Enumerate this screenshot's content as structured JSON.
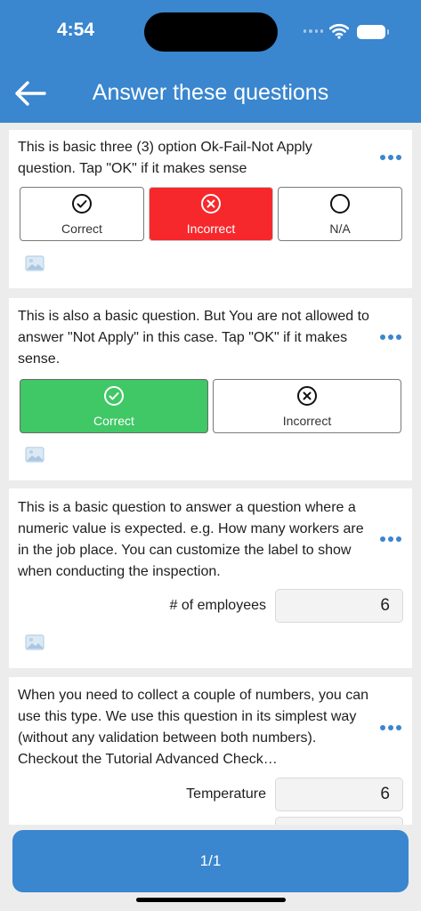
{
  "status_bar": {
    "time": "4:54"
  },
  "header": {
    "title": "Answer these questions"
  },
  "questions": [
    {
      "text": "This is basic three (3) option  Ok-Fail-Not Apply question. Tap \"OK\" if it makes sense",
      "options": [
        {
          "label": "Correct",
          "icon": "check-circle-icon",
          "state": "unselected"
        },
        {
          "label": "Incorrect",
          "icon": "x-circle-icon",
          "state": "selected"
        },
        {
          "label": "N/A",
          "icon": "empty-circle-icon",
          "state": "unselected"
        }
      ]
    },
    {
      "text": "This is also a basic question. But You are not allowed to answer \"Not Apply\" in this case. Tap \"OK\" if it makes sense.",
      "options": [
        {
          "label": "Correct",
          "icon": "check-circle-icon",
          "state": "selected"
        },
        {
          "label": "Incorrect",
          "icon": "x-circle-icon",
          "state": "unselected"
        }
      ]
    },
    {
      "text": "This is a basic question to answer a question where a numeric value is expected. e.g. How many workers are in the job place. You can customize the label to show when conducting the inspection.",
      "field_label": "# of employees",
      "field_value": "6"
    },
    {
      "text": "When you need to collect a couple of numbers, you can use this type. We use this question in its simplest way (without any validation between both numbers). Checkout the Tutorial Advanced Check…",
      "field_label": "Temperature",
      "field_value": "6"
    }
  ],
  "footer": {
    "pager": "1/1"
  },
  "colors": {
    "accent": "#3a86cf",
    "fail": "#f6282b",
    "ok": "#40c766",
    "background": "#ececec"
  }
}
